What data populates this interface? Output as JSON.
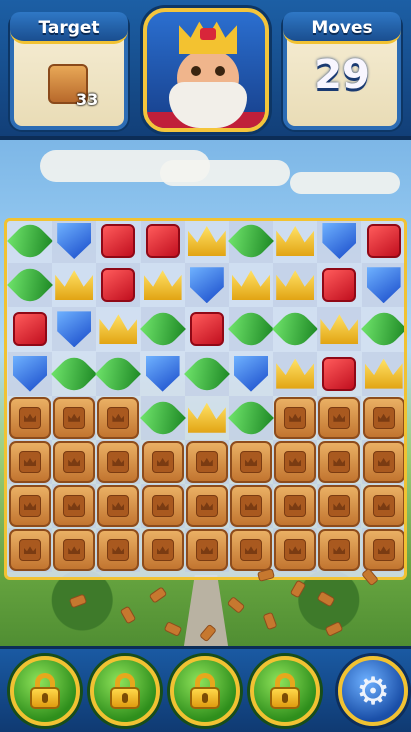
{
  "hud": {
    "target_label": "Target",
    "target_count": "33",
    "target_icon": "crate-icon",
    "moves_label": "Moves",
    "moves_count": "29"
  },
  "board": {
    "columns": 9,
    "rows": 8,
    "grid": [
      [
        "green",
        "blue",
        "red",
        "red",
        "crown",
        "green",
        "crown",
        "blue",
        "red"
      ],
      [
        "green",
        "crown",
        "red",
        "crown",
        "blue",
        "crown",
        "crown",
        "red",
        "blue"
      ],
      [
        "red",
        "blue",
        "crown",
        "green",
        "red",
        "green",
        "green",
        "crown",
        "green"
      ],
      [
        "blue",
        "green",
        "green",
        "blue",
        "green",
        "blue",
        "crown",
        "red",
        "crown"
      ],
      [
        "crate",
        "crate",
        "crate",
        "green",
        "crown",
        "green",
        "crate",
        "crate",
        "crate"
      ],
      [
        "crate",
        "crate",
        "crate",
        "crate",
        "crate",
        "crate",
        "crate",
        "crate",
        "crate"
      ],
      [
        "crate",
        "crate",
        "crate",
        "crate",
        "crate",
        "crate",
        "crate",
        "crate",
        "crate"
      ],
      [
        "crate",
        "crate",
        "crate",
        "crate",
        "crate",
        "crate",
        "crate",
        "crate",
        "crate"
      ]
    ]
  },
  "boosters": [
    {
      "name": "booster-1",
      "icon": "lock-icon",
      "locked": true
    },
    {
      "name": "booster-2",
      "icon": "lock-icon",
      "locked": true
    },
    {
      "name": "booster-3",
      "icon": "lock-icon",
      "locked": true
    },
    {
      "name": "booster-4",
      "icon": "lock-icon",
      "locked": true
    }
  ],
  "settings": {
    "icon": "gear-icon",
    "glyph": "⚙"
  },
  "colors": {
    "hud_blue": "#1c5fa5",
    "board_border": "#f1c232",
    "gem_red": "#c10f1f",
    "gem_blue": "#1749c9",
    "gem_green": "#1f8a26",
    "gem_crown": "#e2a413",
    "crate": "#c27530"
  }
}
